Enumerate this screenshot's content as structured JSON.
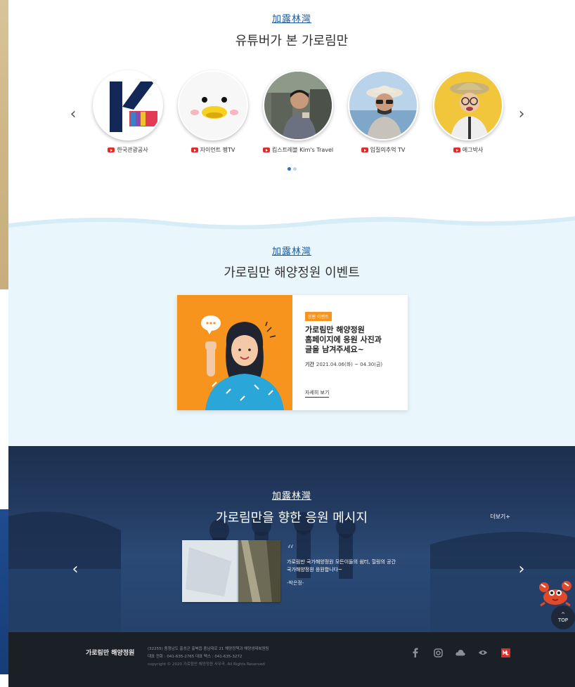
{
  "youtube": {
    "brand": "加露林灣",
    "title": "유튜버가 본 가로림만",
    "prev": "‹",
    "next": "›",
    "channels": [
      {
        "name": "한국관광공사"
      },
      {
        "name": "자이언트 펭TV"
      },
      {
        "name": "킴스트레블 Kim's Travel"
      },
      {
        "name": "입질의추억 TV"
      },
      {
        "name": "에그박사"
      }
    ]
  },
  "event": {
    "brand": "加露林灣",
    "title": "가로림만 해양정원 이벤트",
    "card": {
      "badge": "응원 이벤트",
      "heading_line1": "가로림만 해양정원",
      "heading_line2": "홈페이지에 응원 사진과",
      "heading_line3": "글을 남겨주세요~",
      "period_label": "기간",
      "period_value": "2021.04.06(화) ~ 04.30(금)",
      "more": "자세히 보기"
    }
  },
  "messages": {
    "brand": "加露林灣",
    "title": "가로림만을 향한 응원 메시지",
    "more": "더보기+",
    "prev": "‹",
    "next": "›",
    "quote_mark": "“",
    "text_line1": "가로림만 국가해양정원 모든이들의 쉼터, 힐링의 공간",
    "text_line2": "국가해양정원 응원합니다~",
    "author": "-박은정-"
  },
  "top_button": {
    "arrow": "^",
    "label": "TOP"
  },
  "footer": {
    "brand": "가로림만 해양정원",
    "address": "(32255) 충청남도 홍성군 홍북읍 충남대로 21 해양정책과 해양생태복원팀",
    "contact": "대표 전화 : 041-635-2765    대표 팩스 : 041-635-3272",
    "copyright": "copyright © 2020 가로림만 해양정원 사무국. All Rights Reserved"
  },
  "colors": {
    "brand_blue": "#1c5a9c",
    "event_orange": "#f7941d",
    "event_bg": "#e9f6fb",
    "footer_bg": "#1b1f26",
    "youtube_red": "#e32a2a"
  },
  "icons": [
    "youtube-icon",
    "facebook-icon",
    "instagram-icon",
    "cloud-icon",
    "eye-icon",
    "blog-icon",
    "crab-mascot-icon"
  ]
}
